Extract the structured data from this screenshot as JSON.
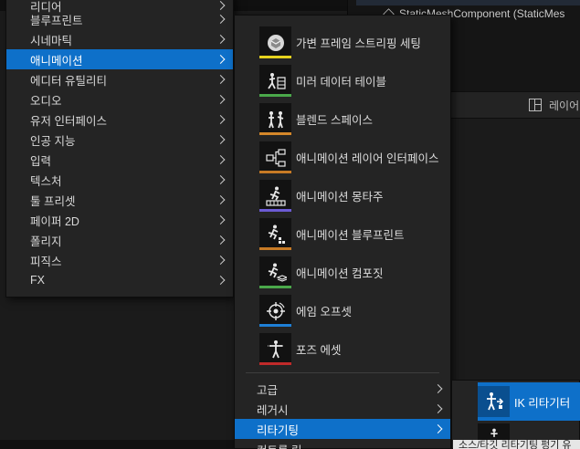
{
  "background": {
    "component_label": "StaticMeshComponent (StaticMes",
    "layer_label": "레이어"
  },
  "menu1": {
    "items": [
      {
        "label": "리디어"
      },
      {
        "label": "블루프린트"
      },
      {
        "label": "시네마틱"
      },
      {
        "label": "애니메이션",
        "selected": true
      },
      {
        "label": "에디터 유틸리티"
      },
      {
        "label": "오디오"
      },
      {
        "label": "유저 인터페이스"
      },
      {
        "label": "인공 지능"
      },
      {
        "label": "입력"
      },
      {
        "label": "텍스처"
      },
      {
        "label": "툴 프리셋"
      },
      {
        "label": "페이퍼 2D"
      },
      {
        "label": "폴리지"
      },
      {
        "label": "피직스"
      },
      {
        "label": "FX"
      }
    ]
  },
  "menu2": {
    "assets": [
      {
        "label": "가변 프레임 스트리핑 세팅",
        "icon": "variable-frame-strip-icon",
        "color": "#e6d21e"
      },
      {
        "label": "미러 데이터 테이블",
        "icon": "mirror-table-icon",
        "color": "#4aa84a"
      },
      {
        "label": "블렌드 스페이스",
        "icon": "blend-space-icon",
        "color": "#d4872a"
      },
      {
        "label": "애니메이션 레이어 인터페이스",
        "icon": "layer-interface-icon",
        "color": "#c77a25"
      },
      {
        "label": "애니메이션 몽타주",
        "icon": "montage-icon",
        "color": "#6c5bd4"
      },
      {
        "label": "애니메이션 블루프린트",
        "icon": "anim-blueprint-icon",
        "color": "#c77a25"
      },
      {
        "label": "애니메이션 컴포짓",
        "icon": "anim-composite-icon",
        "color": "#4aa84a"
      },
      {
        "label": "에임 오프셋",
        "icon": "aim-offset-icon",
        "color": "#1e7fd6"
      },
      {
        "label": "포즈 에셋",
        "icon": "pose-asset-icon",
        "color": "#c02a2a"
      }
    ],
    "items": [
      {
        "label": "고급"
      },
      {
        "label": "레거시"
      },
      {
        "label": "리타기팅",
        "selected": true
      },
      {
        "label": "컨트롤 릭"
      }
    ]
  },
  "menu3": {
    "ik_retargeter_label": "IK 리타기터",
    "tooltip": "소스/타깃 리타기팅 펑기 유"
  }
}
